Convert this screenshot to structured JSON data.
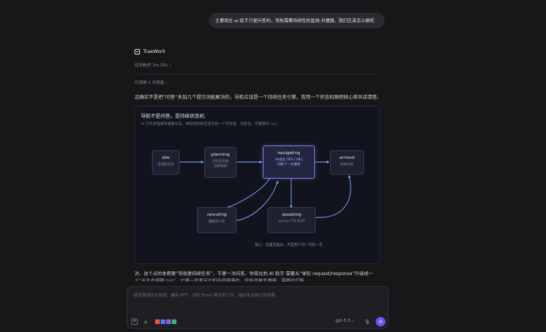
{
  "chat": {
    "user_message": "主要现在 ai 助手只是问答的，导航需要持续性的监测-并播报，我们应该怎么做呢",
    "agent_name": "TraeWork",
    "task_time": "任务耗时 1m 16s",
    "skills_used": "已调用 1 次技能",
    "intro": "这确实不是把“问答”多加几个提示词能解决的，导航应该是一个持续任务引擎。我用一个状态机图把核心差异讲清楚。"
  },
  "card": {
    "title": "导航不是问答，是持续状态机",
    "subtitle": "AI 只负责理解和播报文案，导航控制权应该交给一个可恢复、可取消、可重算的 run。",
    "nodes": {
      "idle": {
        "title": "idle",
        "sub": "无导航任务"
      },
      "planning": {
        "title": "planning",
        "sub1": "识别目的地",
        "sub2": "拉取路线"
      },
      "navigating": {
        "title": "navigating",
        "sub1": "持续收 GPS / IMU",
        "sub2": "判断下一次播报"
      },
      "arrived": {
        "title": "arrived",
        "sub": "结束任务"
      },
      "rerouting": {
        "title": "rerouting",
        "sub": "偏航或卡住"
      },
      "speaking": {
        "title": "speaking",
        "sub": "server TTS PCM"
      }
    },
    "note": "核心：位置流驱动，不是用户问一句答一句"
  },
  "after": {
    "p2": "对。这个点的本质是“导航是持续任务”，不是一次问答。你现在的 AI 助手 需要从“单轮 request/response”升级成一",
    "p3": "个“长生命周期 run”，它要一直拿定位和传感器事件，按条件触发播报，需要时打断。"
  },
  "composer": {
    "placeholder": "帮你整理论文综述、编写 PPT、分析 Excel 等日常工作，输出专业级工作成果。",
    "model": "gpt-5.5",
    "tool_colors": [
      "#e8553d",
      "#4a7df0",
      "#8a5cf0",
      "#3bb36e"
    ]
  },
  "colors": {
    "accent": "#6e56f7",
    "node_active_border": "#7b7be0",
    "arrow": "#7aa8ff"
  }
}
